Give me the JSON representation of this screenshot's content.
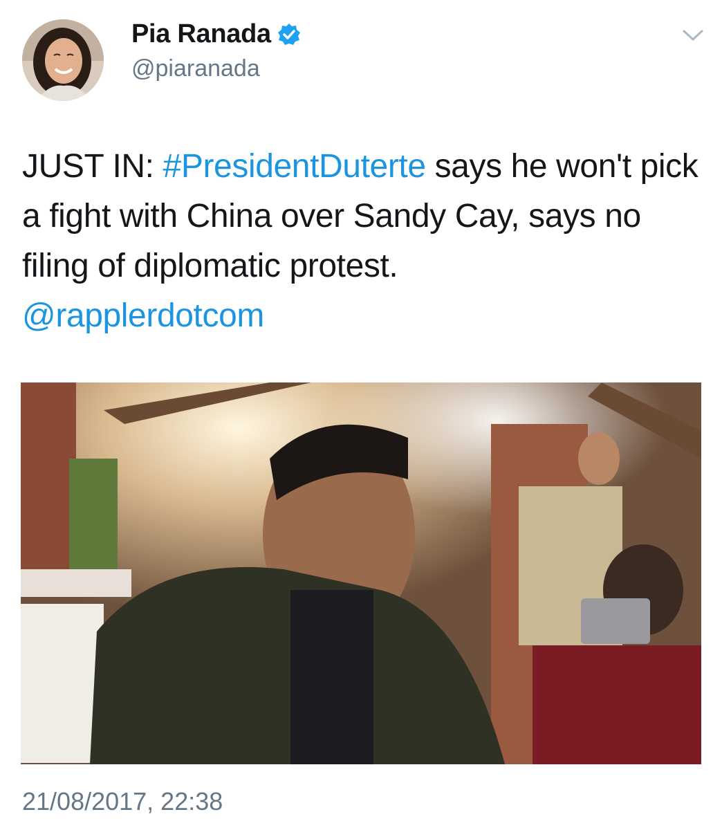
{
  "author": {
    "display_name": "Pia Ranada",
    "handle": "@piaranada",
    "verified": true,
    "avatar_icon": "profile-photo"
  },
  "tweet": {
    "text_prefix": "JUST IN: ",
    "hashtag": "#PresidentDuterte",
    "text_main": " says he won't pick a fight with China over Sandy Cay, says no filing of diplomatic protest.",
    "mention": "@rapplerdotcom",
    "timestamp": "21/08/2017, 22:38"
  },
  "media": {
    "type": "photo",
    "alt_icon": "photo-of-people-at-restaurant"
  },
  "colors": {
    "link": "#1b95e0",
    "secondary_text": "#657786",
    "verified_badge": "#1da1f2"
  },
  "icons": {
    "verified": "verified-badge-icon",
    "menu": "chevron-down-icon"
  }
}
